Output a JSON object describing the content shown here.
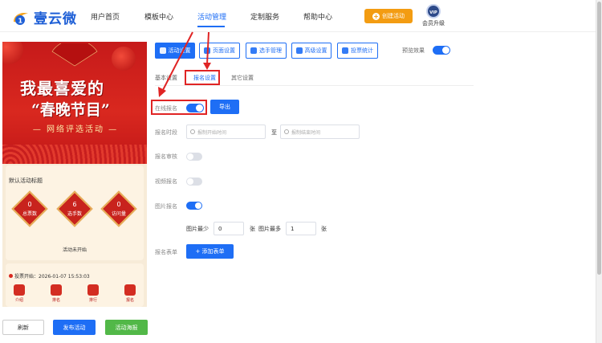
{
  "brand": {
    "name": "壹云微",
    "color": "#1e5fd6"
  },
  "nav": [
    {
      "label": "用户首页",
      "active": false
    },
    {
      "label": "模板中心",
      "active": false
    },
    {
      "label": "活动管理",
      "active": true
    },
    {
      "label": "定制服务",
      "active": false
    },
    {
      "label": "帮助中心",
      "active": false
    }
  ],
  "header": {
    "create_label": "创建活动",
    "vip_badge": "VIP",
    "vip_label": "会员升级"
  },
  "preview": {
    "title_line1": "我最喜爱的",
    "title_line2": "“春晚节目”",
    "subtitle": "— 网络评选活动 —",
    "activity_title": "默认活动标题",
    "stats": [
      {
        "value": "0",
        "label": "总票数"
      },
      {
        "value": "6",
        "label": "选手数"
      },
      {
        "value": "0",
        "label": "访问量"
      }
    ],
    "status": "活动未开始",
    "vote_start": "投票开始：2026-01-07 15:53:03",
    "mini_nav": [
      "介绍",
      "排名",
      "排行",
      "报名"
    ]
  },
  "bottom": {
    "refresh": "刷新",
    "publish": "发布活动",
    "poster": "活动海报"
  },
  "toolbar": {
    "tabs": [
      {
        "label": "活动设置",
        "active": true,
        "icon": "gear-icon"
      },
      {
        "label": "页面设置",
        "active": false,
        "icon": "layout-icon"
      },
      {
        "label": "选手管理",
        "active": false,
        "icon": "users-icon"
      },
      {
        "label": "高级设置",
        "active": false,
        "icon": "sliders-icon"
      },
      {
        "label": "投票统计",
        "active": false,
        "icon": "chart-icon"
      }
    ],
    "preview_label": "预览效果",
    "preview_on": true
  },
  "subtabs": [
    {
      "label": "基本设置",
      "active": false
    },
    {
      "label": "报名设置",
      "active": true
    },
    {
      "label": "其它设置",
      "active": false
    }
  ],
  "form": {
    "online_signup": {
      "label": "在线报名",
      "on": true,
      "export": "导出"
    },
    "signup_time": {
      "label": "报名时段",
      "start_placeholder": "报制开始时间",
      "to": "至",
      "end_placeholder": "报制结束时间"
    },
    "signup_review": {
      "label": "报名审核",
      "on": false
    },
    "video_signup": {
      "label": "视频报名",
      "on": false
    },
    "image_signup": {
      "label": "图片报名",
      "on": true
    },
    "image_limits": {
      "min_label": "图片最少",
      "min_value": "0",
      "min_unit": "张",
      "max_label": "图片最多",
      "max_value": "1",
      "max_unit": "张"
    },
    "signup_form": {
      "label": "报名表单",
      "add_button": "+ 添加表单"
    }
  },
  "accent": "#1e6ef5",
  "highlight": "#e02424"
}
